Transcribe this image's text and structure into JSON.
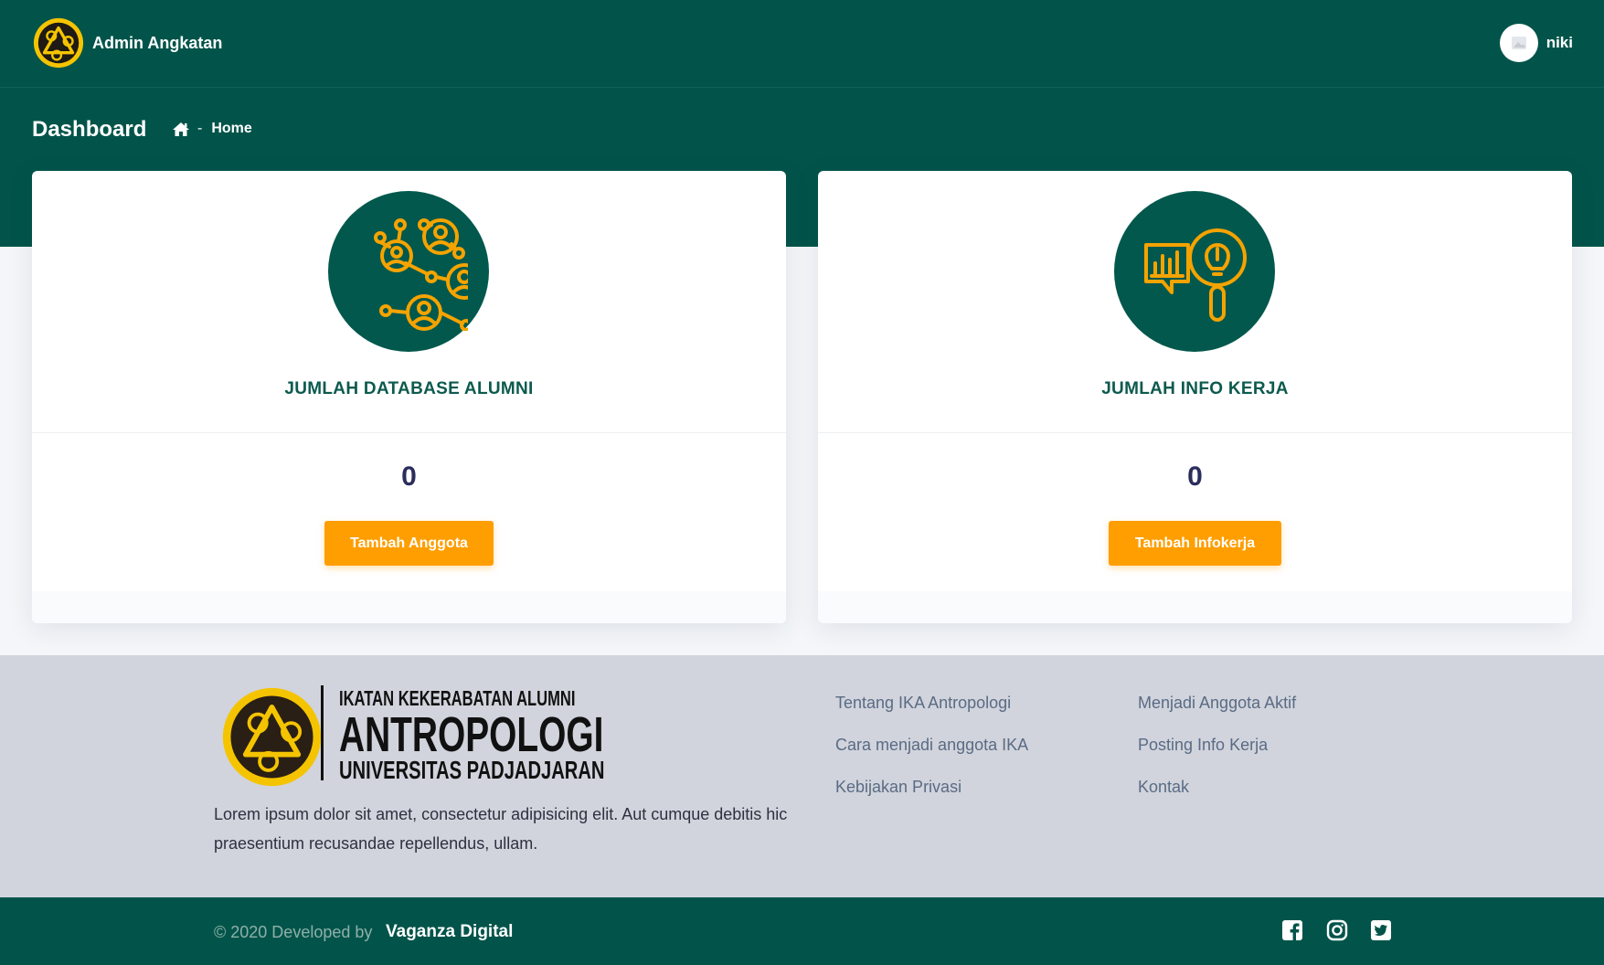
{
  "header": {
    "app_name": "Admin Angkatan",
    "user_name": "niki"
  },
  "page": {
    "title": "Dashboard",
    "breadcrumb_separator": "-",
    "breadcrumb_current": "Home"
  },
  "cards": [
    {
      "title": "JUMLAH DATABASE ALUMNI",
      "count": "0",
      "button_label": "Tambah Anggota",
      "icon": "alumni-network-icon"
    },
    {
      "title": "JUMLAH INFO KERJA",
      "count": "0",
      "button_label": "Tambah Infokerja",
      "icon": "job-info-icon"
    }
  ],
  "footer": {
    "logo_line1": "IKATAN KEKERABATAN ALUMNI",
    "logo_line2": "ANTROPOLOGI",
    "logo_line3": "UNIVERSITAS PADJADJARAN",
    "description": "Lorem ipsum dolor sit amet, consectetur adipisicing elit. Aut cumque debitis hic praesentium recusandae repellendus, ullam.",
    "links_col1": [
      "Tentang IKA Antropologi",
      "Cara menjadi anggota IKA",
      "Kebijakan Privasi"
    ],
    "links_col2": [
      "Menjadi Anggota Aktif",
      "Posting Info Kerja",
      "Kontak"
    ]
  },
  "bottombar": {
    "copyright": "© 2020 Developed by",
    "developer": "Vaganza Digital",
    "social_icons": [
      "facebook-icon",
      "instagram-icon",
      "twitter-icon"
    ]
  },
  "colors": {
    "primary": "#02544a",
    "accent": "#ff9e00",
    "logo_yellow": "#f5c400"
  }
}
